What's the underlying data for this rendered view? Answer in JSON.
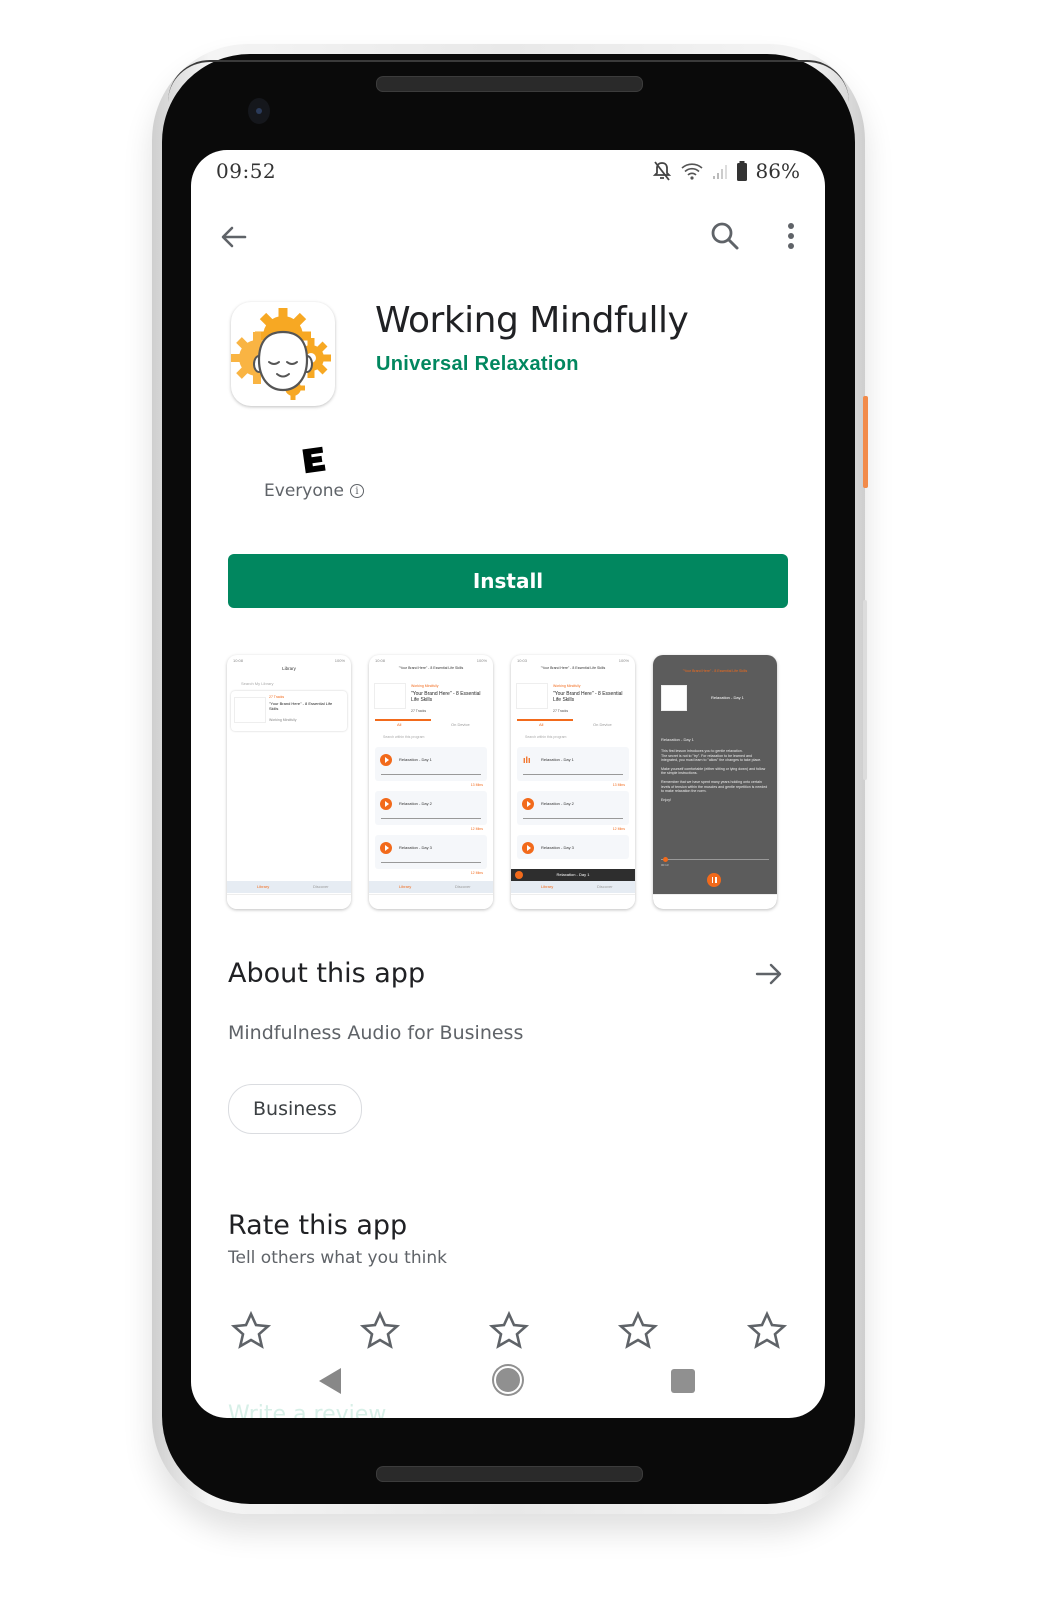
{
  "status_bar": {
    "time": "09:52",
    "battery": "86%",
    "icons": [
      "notifications-off-icon",
      "wifi-icon",
      "signal-icon",
      "battery-icon"
    ]
  },
  "top_bar": {
    "back_icon": "arrow-back-icon",
    "search_icon": "search-icon",
    "more_icon": "more-vert-icon"
  },
  "app": {
    "title": "Working Mindfully",
    "developer": "Universal Relaxation",
    "content_rating_letter": "E",
    "content_rating_label": "Everyone",
    "info_glyph": "i",
    "install_label": "Install"
  },
  "screenshots": [
    {
      "theme": "light",
      "time": "10:08",
      "battery": "100%",
      "header": "Library",
      "search": "Search My Library",
      "card_tracks": "27 Tracks",
      "card_title": "\"Your Brand Here\" - 8 Essential Life Skills",
      "card_author": "Working Mindfully",
      "nav": [
        "Library",
        "Discover"
      ]
    },
    {
      "theme": "light",
      "time": "10:08",
      "battery": "100%",
      "header": "\"Your Brand Here\" - 8 Essential Life Skills",
      "program_author": "Working Mindfully",
      "program_title": "\"Your Brand Here\" - 8 Essential Life Skills",
      "tracks": "27 Tracks",
      "tabs": [
        "All",
        "On Device"
      ],
      "search": "Search within this program",
      "items": [
        {
          "title": "Relaxation - Day 1",
          "duration": "13 Mins"
        },
        {
          "title": "Relaxation - Day 2",
          "duration": "12 Mins"
        },
        {
          "title": "Relaxation - Day 3",
          "duration": "12 Mins"
        }
      ],
      "nav": [
        "Library",
        "Discover"
      ]
    },
    {
      "theme": "light",
      "time": "10:03",
      "battery": "100%",
      "header": "\"Your Brand Here\" - 8 Essential Life Skills",
      "program_author": "Working Mindfully",
      "program_title": "\"Your Brand Here\" - 8 Essential Life Skills",
      "tracks": "27 Tracks",
      "tabs": [
        "All",
        "On Device"
      ],
      "search": "Search within this program",
      "items": [
        {
          "title": "Relaxation - Day 1",
          "duration": "13 Mins"
        },
        {
          "title": "Relaxation - Day 2",
          "duration": "12 Mins"
        },
        {
          "title": "Relaxation - Day 3",
          "duration": ""
        }
      ],
      "mini_player": "Relaxation - Day 1",
      "nav": [
        "Library",
        "Discover"
      ]
    },
    {
      "theme": "dark",
      "header": "\"Your Brand Here\" - 8 Essential Life Skills",
      "track_title": "Relaxation - Day 1",
      "body_title": "Relaxation - Day 1",
      "body": [
        "This first lesson introduces you to gentle relaxation.",
        "The secret is not to \"try\". For relaxation to be learned and integrated, you must learn to \"allow\" the changes to take place.",
        "Make yourself comfortable (either sitting or lying down) and follow the simple instructions.",
        "Remember that we have spent many years holding onto certain levels of tension within the muscles and gentle repetition is needed to make relaxation the norm.",
        "Enjoy!"
      ],
      "elapsed": "00:13"
    }
  ],
  "about": {
    "title": "About this app",
    "description": "Mindfulness Audio for Business",
    "category_chip": "Business"
  },
  "rate": {
    "title": "Rate this app",
    "subtitle": "Tell others what you think",
    "stars_total": 5,
    "stars_selected": 0,
    "write_review": "Write a review"
  },
  "colors": {
    "accent_green": "#01875f",
    "shot_orange": "#f26a1b",
    "icon_orange": "#f5a623"
  }
}
